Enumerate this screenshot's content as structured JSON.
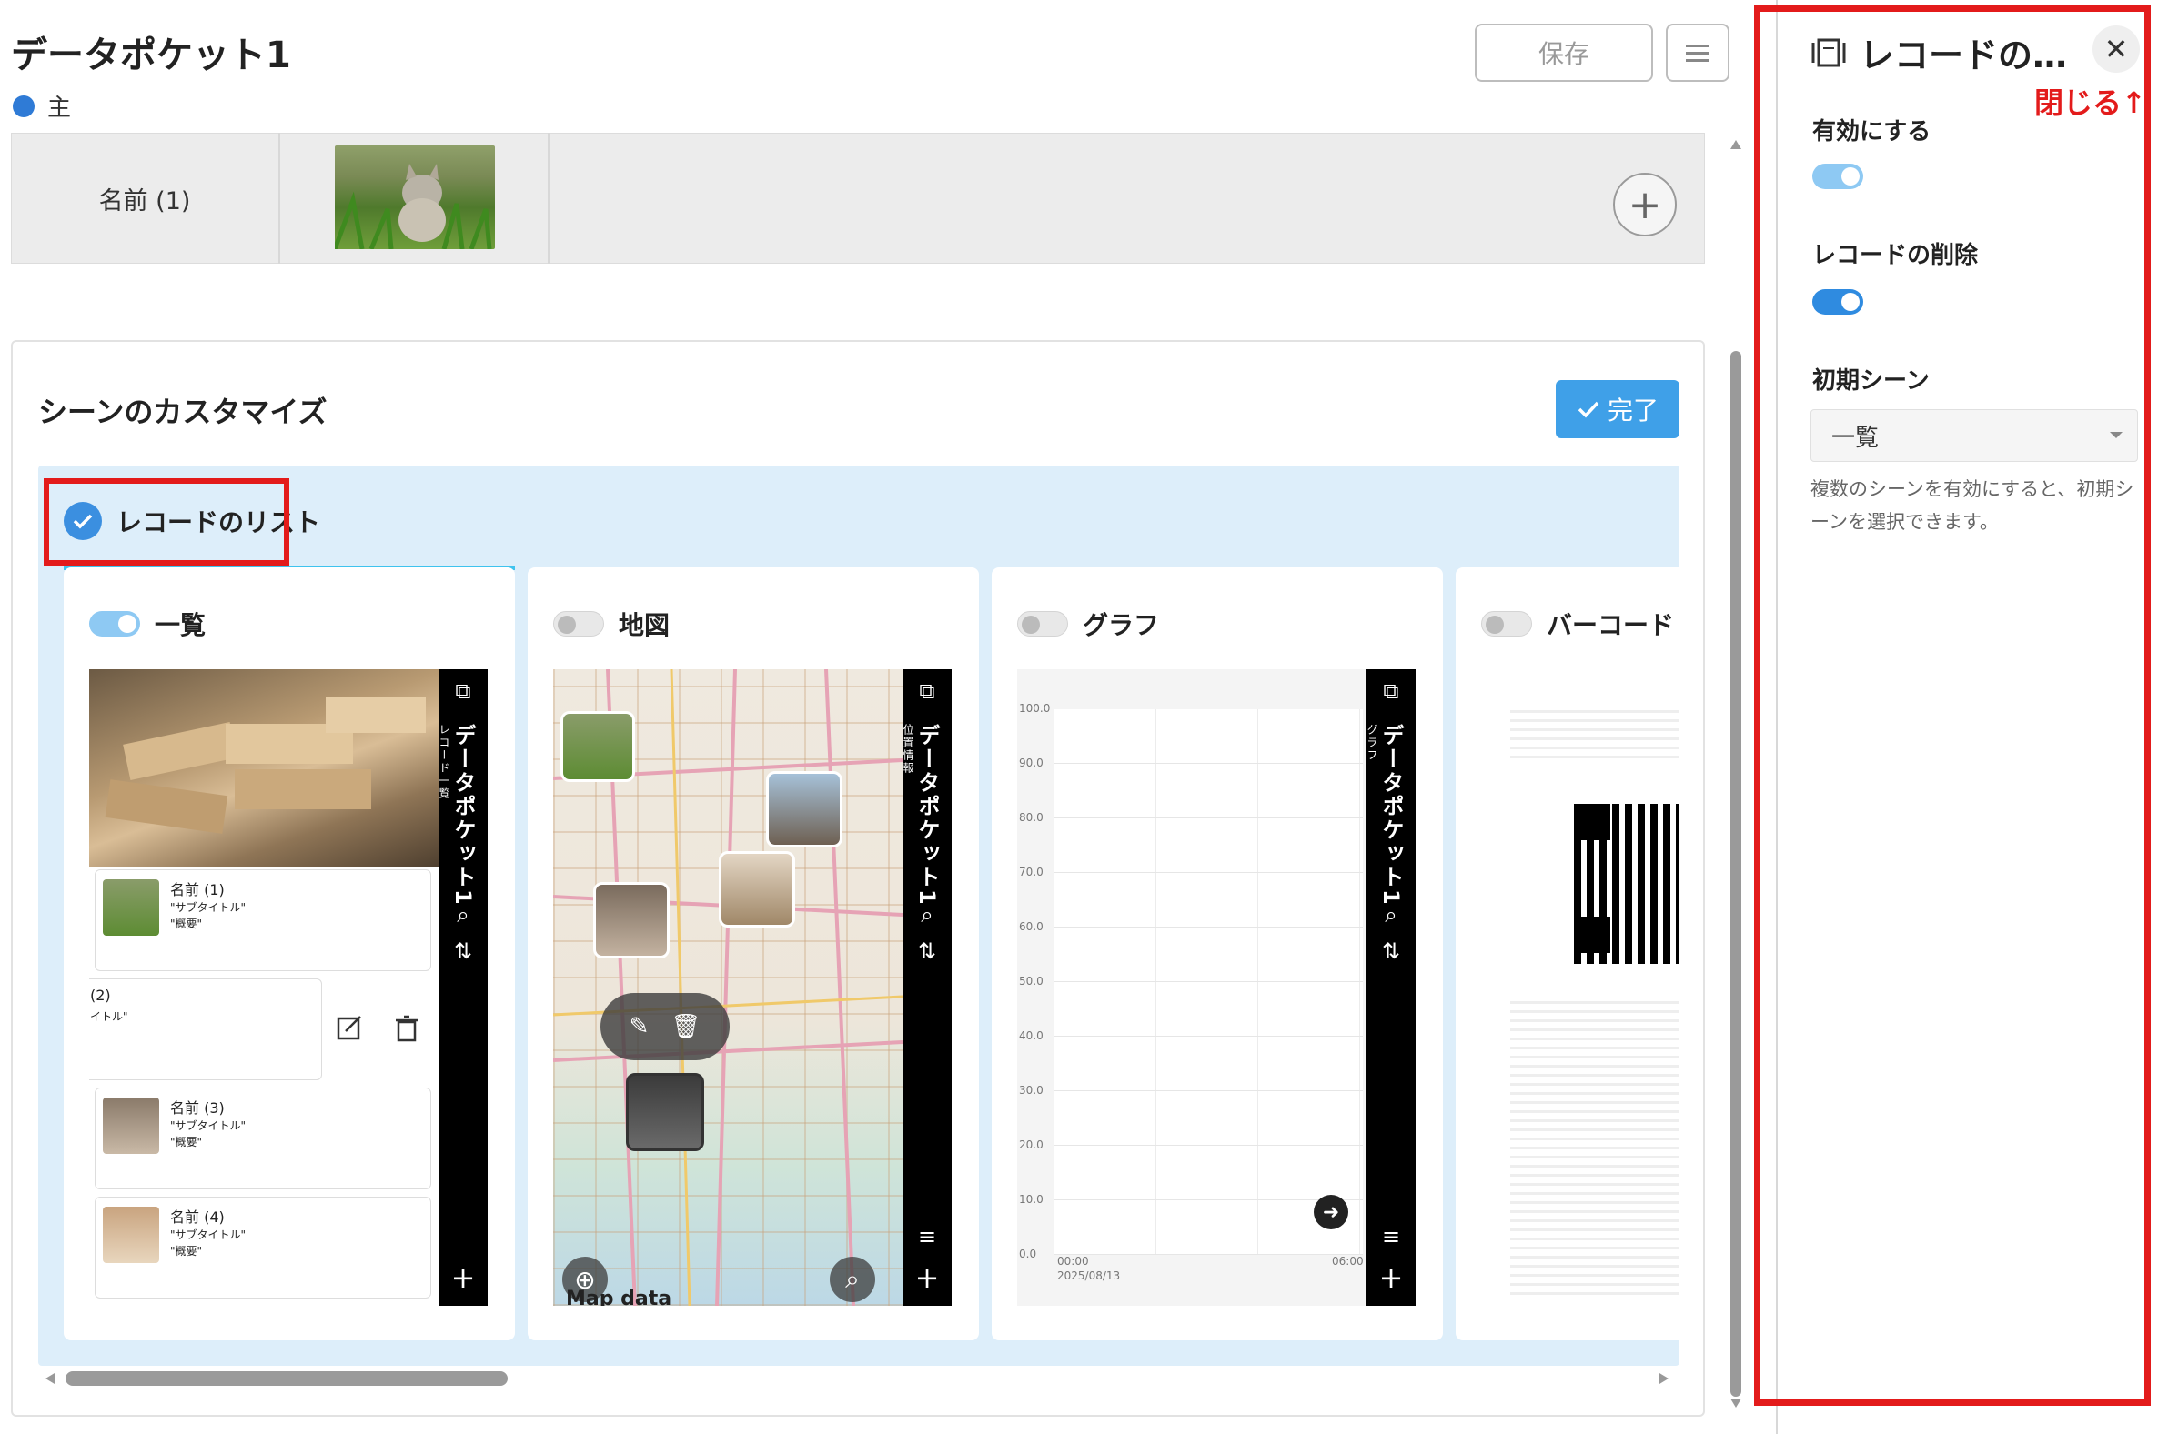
{
  "header": {
    "title": "データポケット1",
    "role_label": "主",
    "save_label": "保存"
  },
  "record_strip": {
    "name_cell": "名前 (1)"
  },
  "scene_customize": {
    "title": "シーンのカスタマイズ",
    "done_label": "完了",
    "list_group_label": "レコードのリスト",
    "cards": [
      {
        "label": "一覧",
        "enabled": true
      },
      {
        "label": "地図",
        "enabled": false
      },
      {
        "label": "グラフ",
        "enabled": false
      },
      {
        "label": "バーコード",
        "enabled": false
      }
    ],
    "list_preview": {
      "side_title": "データポケット1",
      "side_subtitle": "レコード一覧",
      "records": [
        {
          "name": "名前 (1)",
          "subtitle": "\"サブタイトル\"",
          "summary": "\"概要\""
        },
        {
          "name": "(2)",
          "subtitle": "イトル\""
        },
        {
          "name": "名前 (3)",
          "subtitle": "\"サブタイトル\"",
          "summary": "\"概要\""
        },
        {
          "name": "名前 (4)",
          "subtitle": "\"サブタイトル\"",
          "summary": "\"概要\""
        }
      ]
    },
    "map_preview": {
      "side_title": "データポケット1",
      "side_subtitle": "位置情報",
      "footer_text": "Map data"
    },
    "graph_preview": {
      "side_title": "データポケット1",
      "side_subtitle": "グラフ",
      "y_ticks": [
        "100.0",
        "90.0",
        "80.0",
        "70.0",
        "60.0",
        "50.0",
        "40.0",
        "30.0",
        "20.0",
        "10.0",
        "0.0"
      ],
      "x_start_time": "00:00",
      "x_start_date": "2025/08/13",
      "x_end_time": "06:00"
    }
  },
  "right_panel": {
    "title": "レコードの…",
    "close_annotation": "閉じる↑",
    "enable_label": "有効にする",
    "enable_on": true,
    "delete_label": "レコードの削除",
    "delete_on": true,
    "initial_scene_label": "初期シーン",
    "initial_scene_value": "一覧",
    "help_text": "複数のシーンを有効にすると、初期シーンを選択できます。"
  },
  "colors": {
    "accent": "#3fa0e8",
    "highlight_red": "#e31b1b",
    "scene_bg": "#ddeefa"
  }
}
